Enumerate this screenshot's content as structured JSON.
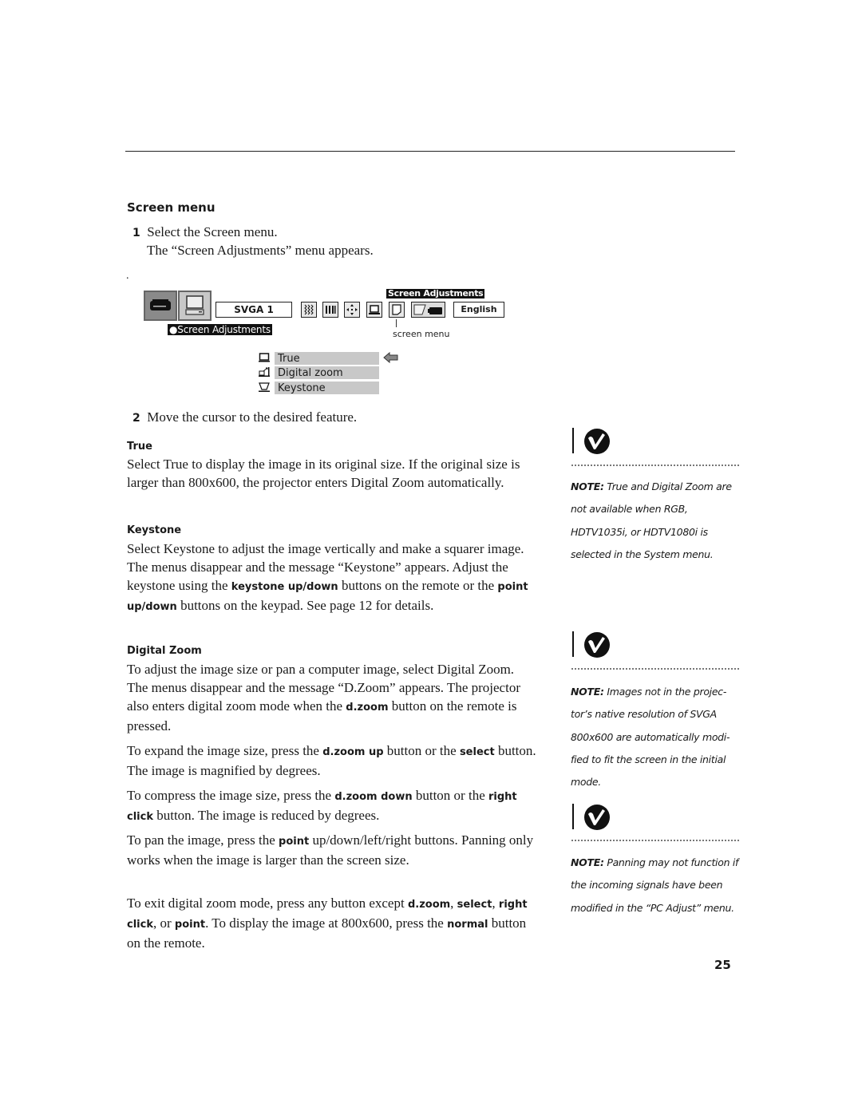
{
  "section_title": "Screen menu",
  "steps": [
    {
      "number": "1",
      "text": "Select the Screen menu.",
      "subtext": "The “Screen Adjustments” menu appears."
    },
    {
      "number": "2",
      "text": "Move the cursor to the desired feature."
    }
  ],
  "stray_mark": ".",
  "osd": {
    "source_label": "SVGA 1",
    "language_label": "English",
    "top_label": "Screen Adjustments",
    "main_label": "●Screen Adjustments",
    "callout": "screen menu",
    "toolbar_icons": [
      "projector-icon",
      "computer-icon",
      "image-adjust-icon",
      "sound-icon",
      "position-icon",
      "screen-icon",
      "screen-menu-icon",
      "setting-icon"
    ],
    "menu_items": [
      {
        "label": "True",
        "icon": "true-size-icon",
        "selected": true
      },
      {
        "label": "Digital zoom",
        "icon": "digital-zoom-icon",
        "selected": false
      },
      {
        "label": "Keystone",
        "icon": "keystone-icon",
        "selected": false
      }
    ],
    "cursor_icon": "pointer-arrow-icon"
  },
  "sections": {
    "true": {
      "heading": "True",
      "text": "Select True to display the image in its original size. If the original size is larger than 800x600, the projector enters Digital Zoom automatically."
    },
    "keystone": {
      "heading": "Keystone",
      "text_a": "Select Keystone to adjust the image vertically and make a squarer image. The menus disappear and the message “Keystone” appears. Adjust the keystone using the ",
      "kw_a": "keystone up/down",
      "text_b": " buttons on the remote or the ",
      "kw_b": "point up/down",
      "text_c": " buttons on the keypad. See page 12 for details."
    },
    "digital_zoom": {
      "heading": "Digital Zoom",
      "p1_a": "To adjust the image size or pan a computer image, select Digital Zoom. The menus disappear and the message “D.Zoom” appears. The projector also enters digital zoom mode when the ",
      "p1_kw": "d.zoom",
      "p1_b": " button on the remote is pressed.",
      "p2_a": "To expand the image size, press the ",
      "p2_kw1": "d.zoom up",
      "p2_b": " button or the ",
      "p2_kw2": "select",
      "p2_c": " button. The image is magnified by degrees.",
      "p3_a": "To compress the image size, press the ",
      "p3_kw1": "d.zoom down",
      "p3_b": " button or the ",
      "p3_kw2": "right click",
      "p3_c": " button. The image is reduced by degrees.",
      "p4_a": "To pan the image, press the ",
      "p4_kw": "point",
      "p4_b": " up/down/left/right buttons. Panning only works when the image is larger than the screen size.",
      "p5_a": "To exit digital zoom mode, press any button except ",
      "p5_kw1": "d.zoom",
      "p5_b": ", ",
      "p5_kw2": "select",
      "p5_c": ", ",
      "p5_kw3": "right click",
      "p5_d": ", or ",
      "p5_kw4": "point",
      "p5_e": ". To display the image at 800x600, press the ",
      "p5_kw5": "normal",
      "p5_f": " button on the remote."
    }
  },
  "notes": [
    {
      "label": "NOTE:",
      "text": " True and Digital Zoom are not available when RGB, HDTV1035i, or HDTV1080i is selected in the System menu."
    },
    {
      "label": "NOTE:",
      "text": " Images not in the projec- tor’s native resolution of SVGA 800x600 are automatically modi- fied to fit the screen in the initial mode."
    },
    {
      "label": "NOTE:",
      "text": " Panning may not function if the incoming signals have been modified in the “PC Adjust” menu."
    }
  ],
  "page_number": "25"
}
